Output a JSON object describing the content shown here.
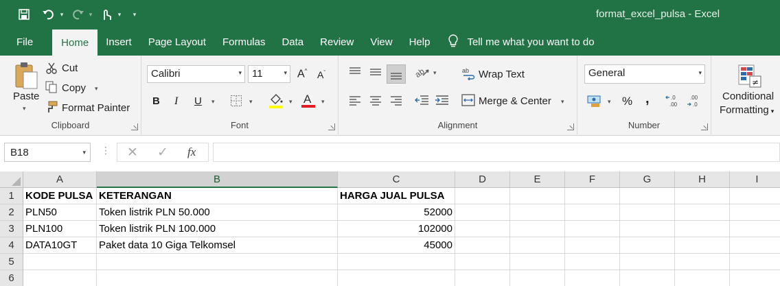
{
  "window": {
    "title": "format_excel_pulsa  -  Excel"
  },
  "tabs": [
    {
      "label": "File"
    },
    {
      "label": "Home"
    },
    {
      "label": "Insert"
    },
    {
      "label": "Page Layout"
    },
    {
      "label": "Formulas"
    },
    {
      "label": "Data"
    },
    {
      "label": "Review"
    },
    {
      "label": "View"
    },
    {
      "label": "Help"
    }
  ],
  "tell_me": {
    "label": "Tell me what you want to do"
  },
  "ribbon": {
    "clipboard": {
      "paste": "Paste",
      "cut": "Cut",
      "copy": "Copy",
      "format_painter": "Format Painter",
      "group": "Clipboard"
    },
    "font": {
      "name": "Calibri",
      "size": "11",
      "bold": "B",
      "italic": "I",
      "underline": "U",
      "group": "Font",
      "fill_color": "#ffff00",
      "font_color": "#e31b23"
    },
    "alignment": {
      "wrap_text": "Wrap Text",
      "merge_center": "Merge & Center",
      "group": "Alignment"
    },
    "number": {
      "format": "General",
      "percent": "%",
      "comma": ",",
      "group": "Number"
    },
    "styles": {
      "conditional": "Conditional",
      "formatting": "Formatting"
    }
  },
  "formula_bar": {
    "name_box": "B18",
    "fx": "fx",
    "value": ""
  },
  "grid": {
    "columns": [
      "A",
      "B",
      "C",
      "D",
      "E",
      "F",
      "G",
      "H",
      "I"
    ],
    "selected_column": "B",
    "rows": [
      {
        "num": "1",
        "cells": [
          "KODE PULSA",
          "KETERANGAN",
          "HARGA JUAL PULSA"
        ]
      },
      {
        "num": "2",
        "cells": [
          "PLN50",
          "Token listrik PLN 50.000",
          "52000"
        ]
      },
      {
        "num": "3",
        "cells": [
          "PLN100",
          "Token listrik PLN 100.000",
          "102000"
        ]
      },
      {
        "num": "4",
        "cells": [
          "DATA10GT",
          "Paket data 10 Giga Telkomsel",
          "45000"
        ]
      },
      {
        "num": "5",
        "cells": [
          "",
          "",
          ""
        ]
      },
      {
        "num": "6",
        "cells": [
          "",
          "",
          ""
        ]
      }
    ]
  },
  "colors": {
    "brand": "#217346",
    "ribbon": "#f3f3f3"
  }
}
